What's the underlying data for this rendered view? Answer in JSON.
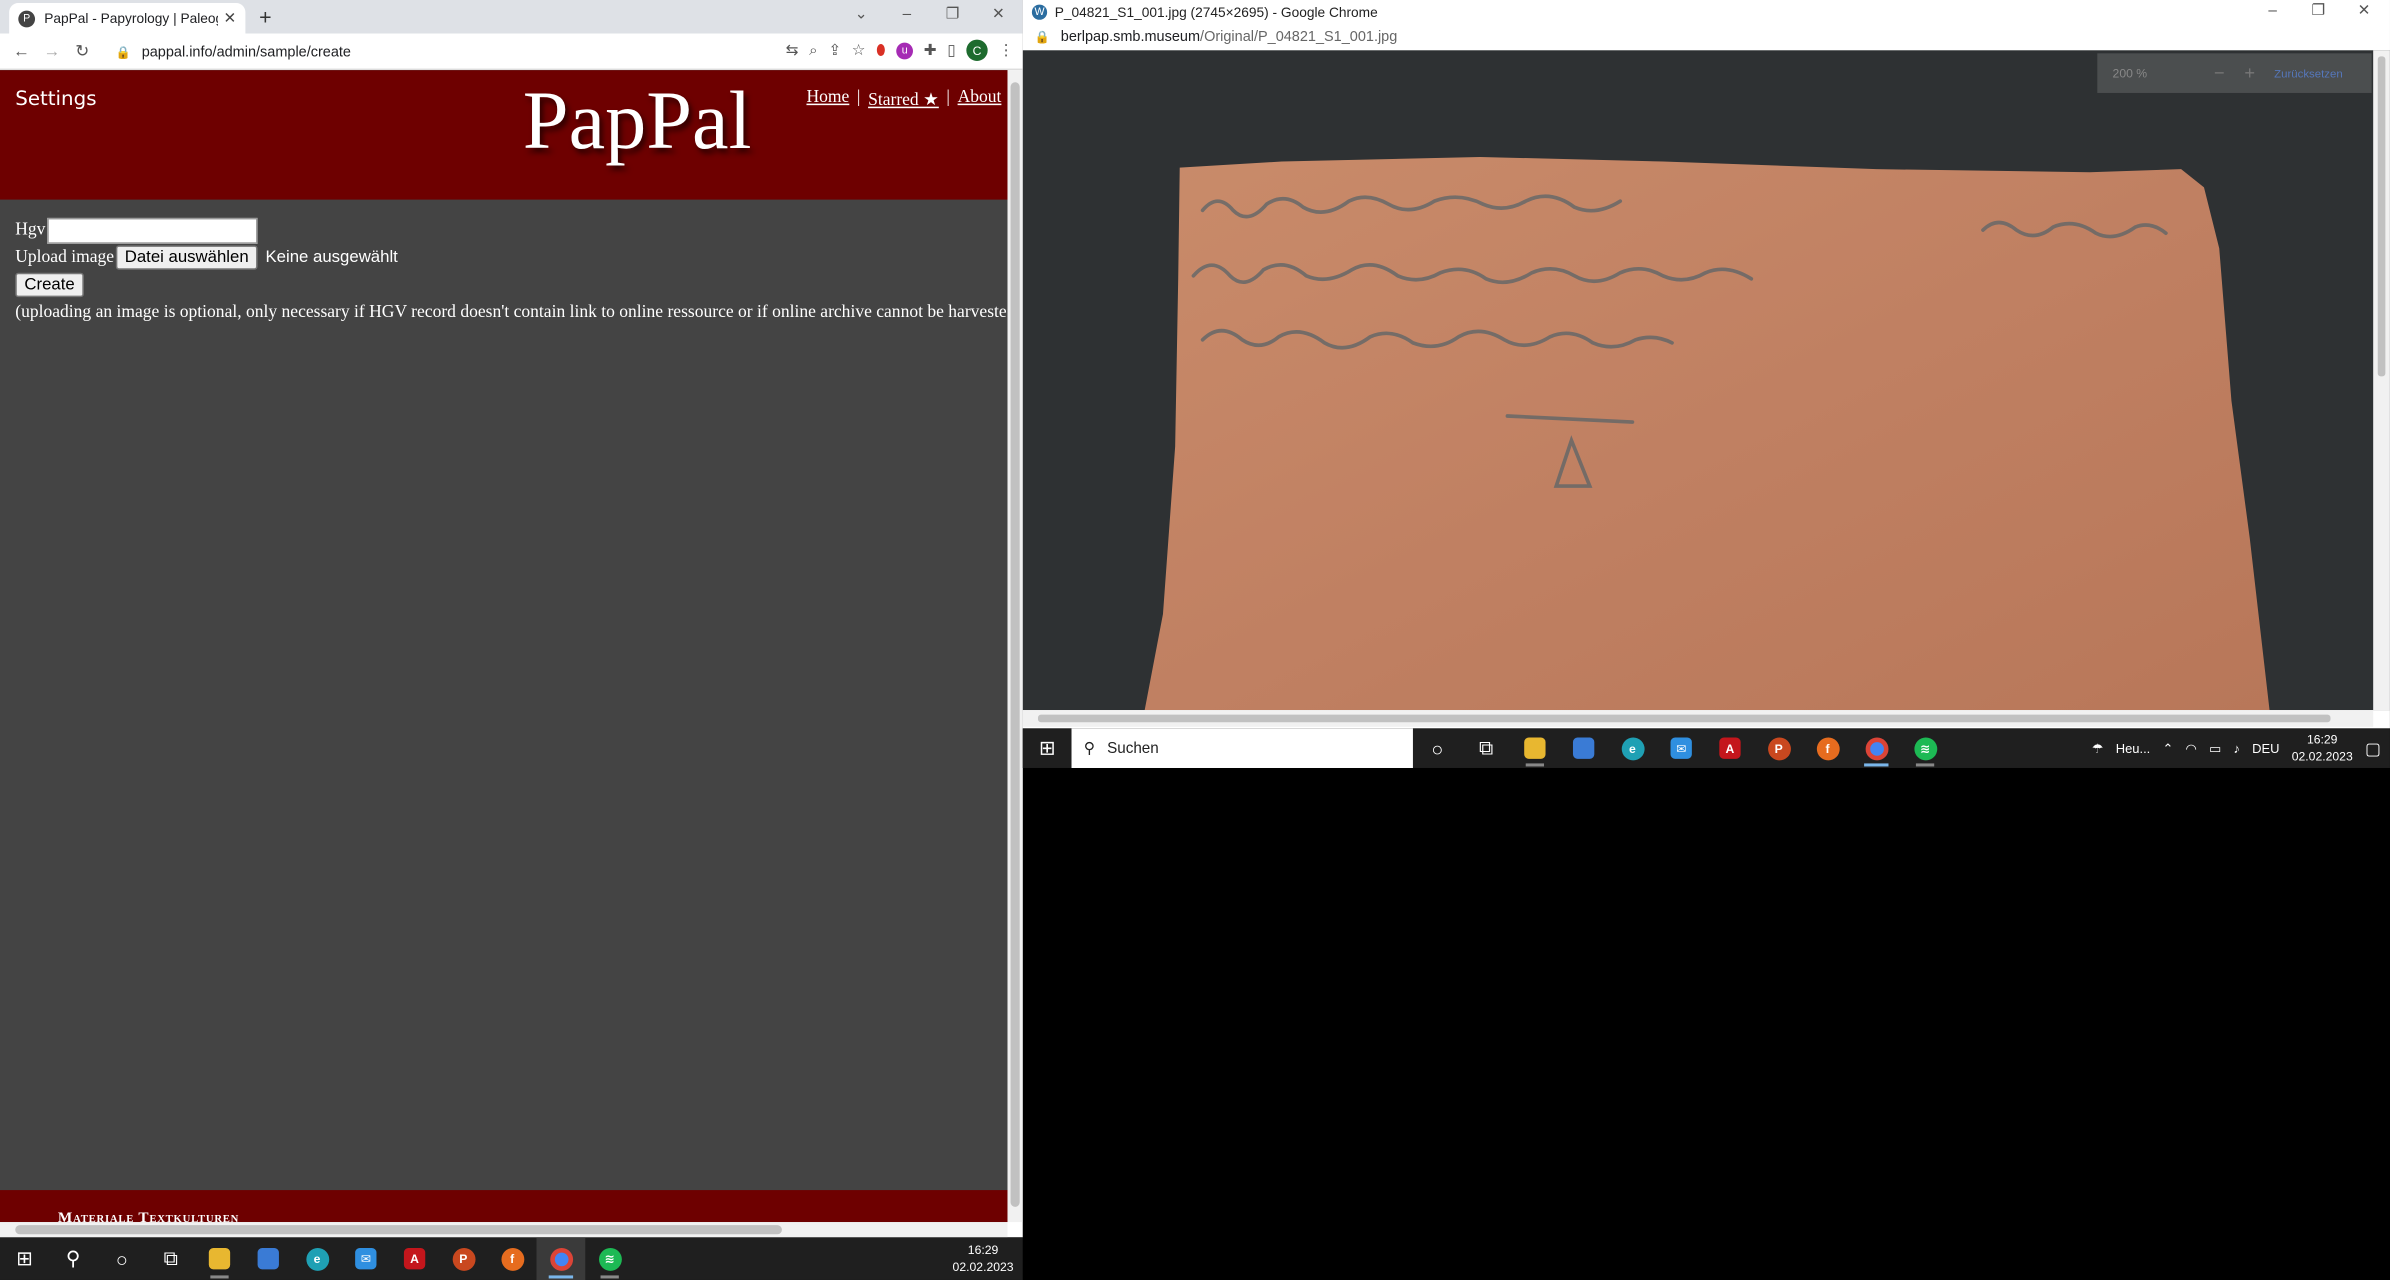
{
  "left_window": {
    "tab_title": "PapPal - Papyrology | Paleograph",
    "url": "pappal.info/admin/sample/create",
    "site": {
      "settings_label": "Settings",
      "logo": "PapPal",
      "nav": {
        "home": "Home",
        "sep1": "|",
        "starred": "Starred ★",
        "sep2": "|",
        "about": "About"
      }
    },
    "form": {
      "hgv_label": "Hgv",
      "upload_label": "Upload image",
      "file_button": "Datei auswählen",
      "file_status": "Keine ausgewählt",
      "create_button": "Create",
      "note": "(uploading an image is optional, only necessary if HGV record doesn't contain link to online ressource or if online archive cannot be harveste"
    },
    "footer_text": "Materiale Textkulturen"
  },
  "right_window": {
    "title": "P_04821_S1_001.jpg (2745×2695) - Google Chrome",
    "url_host": "berlpap.smb.museum",
    "url_path": "/Original/P_04821_S1_001.jpg",
    "viewer": {
      "zoom": "200 %",
      "minus": "−",
      "plus": "+",
      "reset": "Zurücksetzen"
    }
  },
  "taskbar_inner": {
    "search_label": "Suchen",
    "weather": "Heu...",
    "lang": "DEU",
    "time": "16:29",
    "date": "02.02.2023"
  },
  "taskbar_main": {
    "time": "16:29",
    "date": "02.02.2023"
  },
  "colors": {
    "header_red": "#6e0000",
    "page_bg": "#444444",
    "taskbar": "#1f1f1f"
  }
}
